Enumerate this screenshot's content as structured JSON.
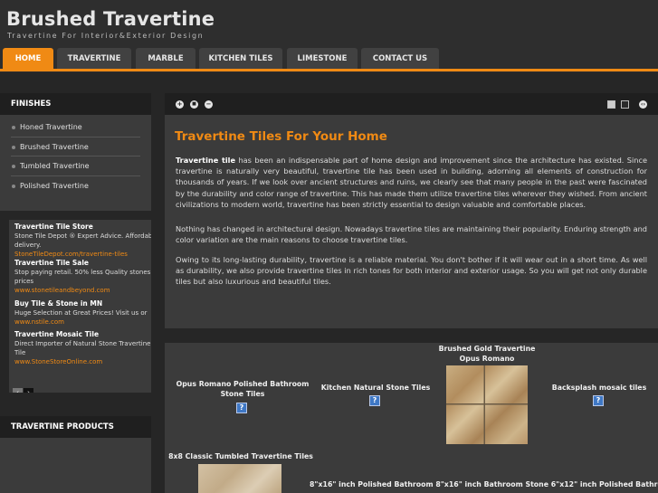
{
  "header": {
    "title": "Brushed Travertine",
    "tagline": "Travertine For Interior&Exterior Design"
  },
  "nav": {
    "tabs": [
      {
        "label": "HOME",
        "active": true
      },
      {
        "label": "TRAVERTINE",
        "active": false
      },
      {
        "label": "MARBLE",
        "active": false
      },
      {
        "label": "KITCHEN TILES",
        "active": false
      },
      {
        "label": "LIMESTONE",
        "active": false
      },
      {
        "label": "CONTACT US",
        "active": false
      }
    ]
  },
  "sidebar": {
    "finishes_title": "FINISHES",
    "finishes": [
      "Honed Travertine",
      "Brushed Travertine",
      "Tumbled Travertine",
      "Polished Travertine"
    ],
    "ads": [
      {
        "title": "Travertine Tile Store",
        "text": [
          "Stone Tile Depot ® Expert Advice. Affordab",
          "delivery."
        ],
        "url": "StoneTileDepot.com/travertine-tiles"
      },
      {
        "title": "Travertine Tile Sale",
        "text": [
          "Stop paying retail. 50% less Quality stones",
          "prices"
        ],
        "url": "www.stonetileandbeyond.com"
      },
      {
        "title": "Buy Tile & Stone in MN",
        "text": [
          "Huge Selection at Great Prices! Visit us or"
        ],
        "url": "www.nstile.com"
      },
      {
        "title": "Travertine Mosaic Tile",
        "text": [
          "Direct Importer of Natural Stone Travertine,",
          "Tile"
        ],
        "url": "www.StoneStoreOnline.com"
      }
    ],
    "ad_prev": "‹",
    "ad_next": "›",
    "products_title": "TRAVERTINE PRODUCTS"
  },
  "toolbar": {
    "plus": "+",
    "stop": "■",
    "minus": "−"
  },
  "main": {
    "heading": "Travertine Tiles For Your Home",
    "p1_bold": "Travertine tile",
    "p1_rest": " has been an indispensable part of home design and improvement since the architecture has existed. Since travertine is naturally very beautiful, travertine tile has been used in building, adorning all elements of construction for thousands of years. If we look over ancient structures and ruins, we clearly see that many people in the past were fascinated by the durability and color range of travertine. This has made them utilize travertine tiles wherever they wished. From ancient civilizations to modern world, travertine has been strictly essential to design valuable and comfortable places.",
    "p2": "Nothing has changed in architectural design. Nowadays travertine tiles are maintaining their popularity. Enduring strength and color variation are the main reasons to choose travertine tiles.",
    "p3": "Owing to its long-lasting durability, travertine is a reliable material. You don't bother if it will wear out in a short time. As well as durability, we also provide travertine tiles in rich tones for both interior and exterior usage. So you will get not only durable tiles but also luxurious and beautiful tiles."
  },
  "gallery": {
    "items": [
      {
        "caption": "Opus Romano Polished Bathroom Stone Tiles"
      },
      {
        "caption": "Kitchen Natural Stone Tiles"
      },
      {
        "caption": "Brushed Gold Travertine Opus Romano"
      },
      {
        "caption": "Backsplash mosaic tiles"
      },
      {
        "caption": "8x8 Classic Tumbled Travertine Tiles"
      },
      {
        "caption": "8\"x16\" inch Polished Bathroom 8\"x16\" inch Bathroom Stone 6\"x12\" inch Polished Bathroom"
      }
    ],
    "qmark": "?"
  },
  "colors": {
    "accent": "#f08a14",
    "background": "#262626",
    "panel": "#3b3b3b"
  }
}
